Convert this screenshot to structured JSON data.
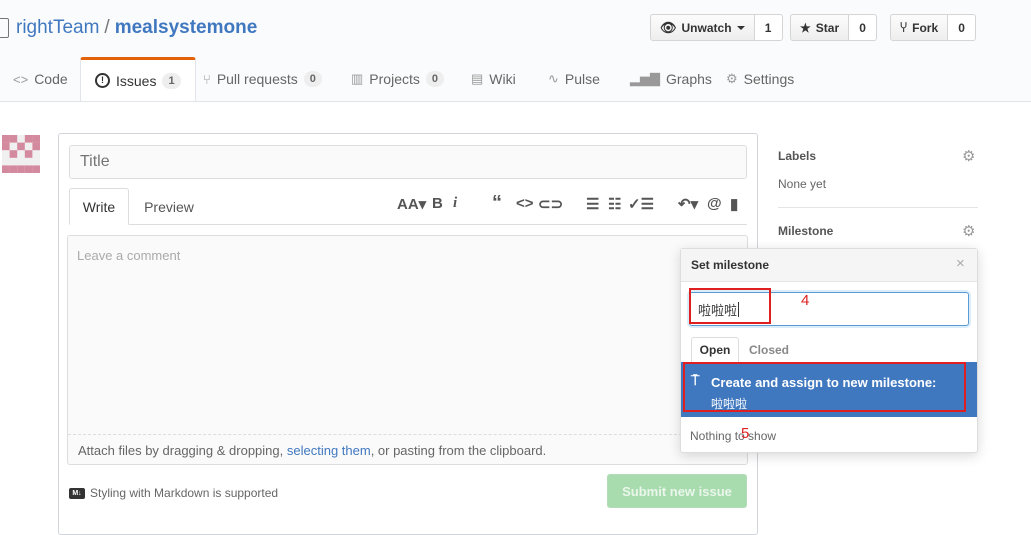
{
  "repo": {
    "owner": "rightTeam",
    "separator": "/",
    "name": "mealsystemone"
  },
  "actions": {
    "watch": {
      "label": "Unwatch",
      "count": "1"
    },
    "star": {
      "label": "Star",
      "count": "0"
    },
    "fork": {
      "label": "Fork",
      "count": "0"
    }
  },
  "tabs": [
    {
      "icon": "code-icon",
      "label": "Code",
      "count": ""
    },
    {
      "icon": "issue-icon",
      "label": "Issues",
      "count": "1"
    },
    {
      "icon": "pull-request-icon",
      "label": "Pull requests",
      "count": "0"
    },
    {
      "icon": "project-icon",
      "label": "Projects",
      "count": "0"
    },
    {
      "icon": "wiki-icon",
      "label": "Wiki",
      "count": ""
    },
    {
      "icon": "pulse-icon",
      "label": "Pulse",
      "count": ""
    },
    {
      "icon": "graph-icon",
      "label": "Graphs",
      "count": ""
    },
    {
      "icon": "gear-icon",
      "label": "Settings",
      "count": ""
    }
  ],
  "editor": {
    "title_placeholder": "Title",
    "write_tab": "Write",
    "preview_tab": "Preview",
    "comment_placeholder": "Leave a comment",
    "attach_before": "Attach files by dragging & dropping, ",
    "attach_link": "selecting them",
    "attach_after": ", or pasting from the clipboard.",
    "markdown_note": "Styling with Markdown is supported",
    "submit": "Submit new issue",
    "toolbar": [
      "AA",
      "B",
      "i",
      "“",
      "<>",
      "link",
      "list",
      "numbered-list",
      "task-list",
      "reply",
      "@",
      "bookmark"
    ]
  },
  "sidebar": {
    "labels_heading": "Labels",
    "labels_value": "None yet",
    "milestone_heading": "Milestone"
  },
  "milestone_popup": {
    "title": "Set milestone",
    "filter_value": "啦啦啦",
    "tab_open": "Open",
    "tab_closed": "Closed",
    "create_label": "Create and assign to new milestone:",
    "create_value": "啦啦啦",
    "empty_text": "Nothing to show"
  },
  "annotations": {
    "step4": "4",
    "step5": "5"
  },
  "colors": {
    "accent": "#4078c0",
    "selected_tab_border": "#e36209",
    "annotation": "#e02020",
    "submit_disabled": "#a8dcae"
  }
}
